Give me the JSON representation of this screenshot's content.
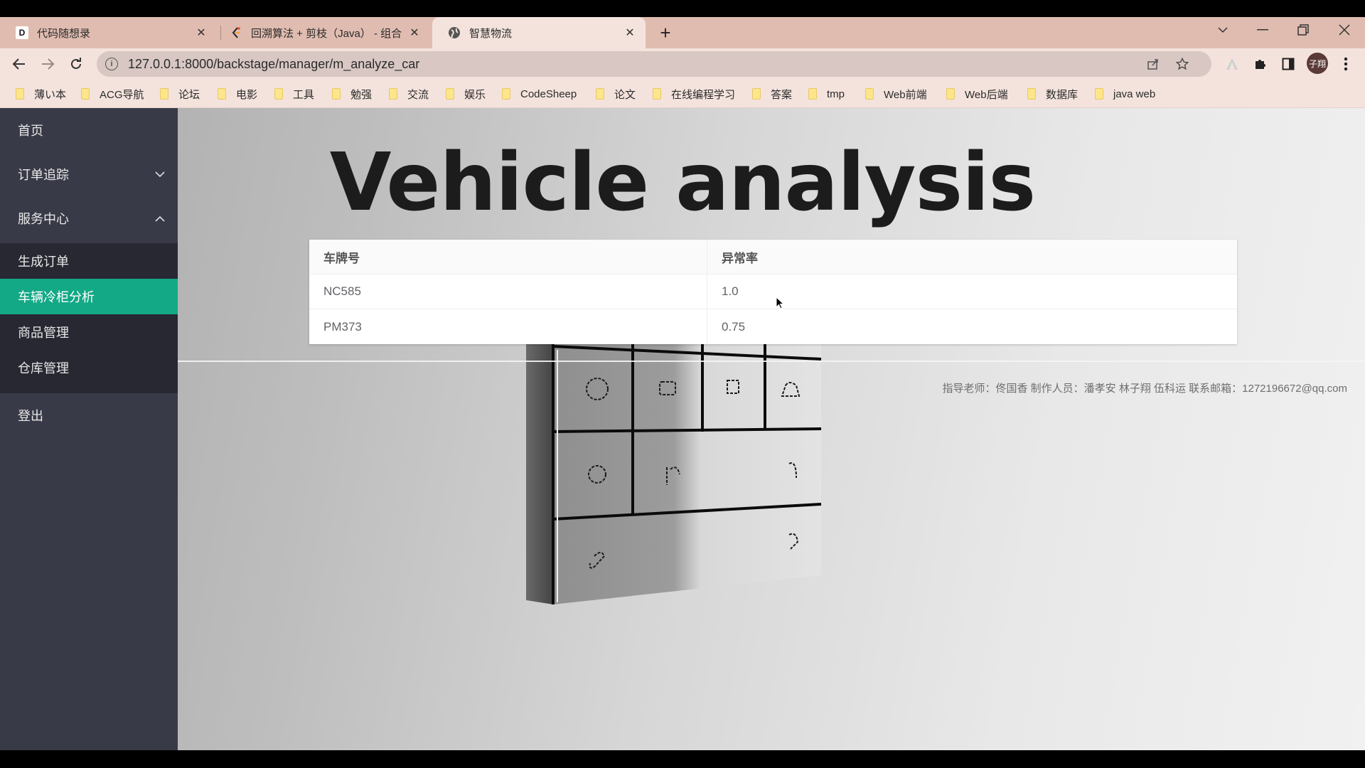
{
  "browser": {
    "tabs": [
      {
        "title": "代码随想录",
        "favicon": "D",
        "active": false
      },
      {
        "title": "回溯算法 + 剪枝（Java） - 组合",
        "favicon": "leetcode-icon",
        "active": false
      },
      {
        "title": "智慧物流",
        "favicon": "globe-icon",
        "active": true
      }
    ],
    "close_glyph": "✕",
    "new_tab_glyph": "+",
    "url": "127.0.0.1:8000/backstage/manager/m_analyze_car",
    "profile_label": "子翔",
    "bookmarks": [
      "薄い本",
      "ACG导航",
      "论坛",
      "电影",
      "工具",
      "勉强",
      "交流",
      "娱乐",
      "CodeSheep",
      "论文",
      "在线编程学习",
      "答案",
      "tmp",
      "Web前端",
      "Web后端",
      "数据库",
      "java web"
    ]
  },
  "sidebar": {
    "items": [
      {
        "label": "首页"
      },
      {
        "label": "订单追踪",
        "expandable": true,
        "expanded": false
      },
      {
        "label": "服务中心",
        "expandable": true,
        "expanded": true
      },
      {
        "label": "登出"
      }
    ],
    "submenu": [
      {
        "label": "生成订单",
        "active": false
      },
      {
        "label": "车辆冷柜分析",
        "active": true
      },
      {
        "label": "商品管理",
        "active": false
      },
      {
        "label": "仓库管理",
        "active": false
      }
    ],
    "active_color": "#13a986"
  },
  "main": {
    "title": "Vehicle analysis",
    "table": {
      "headers": [
        "车牌号",
        "异常率"
      ],
      "rows": [
        [
          "NC585",
          "1.0"
        ],
        [
          "PM373",
          "0.75"
        ]
      ]
    },
    "footer": "指导老师：佟国香 制作人员：潘孝安 林子翔 伍科运 联系邮箱：1272196672@qq.com"
  }
}
